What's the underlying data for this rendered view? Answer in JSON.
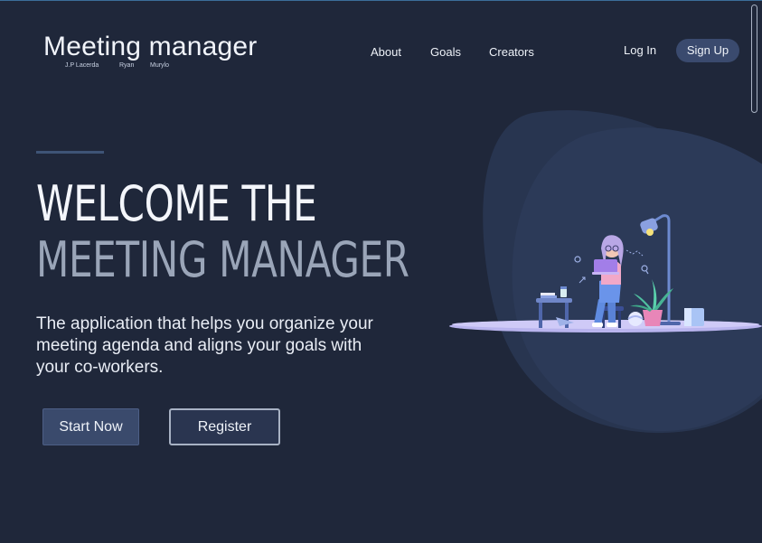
{
  "logo": {
    "title": "Meeting manager",
    "credits": [
      "J.P Lacerda",
      "Ryan",
      "Murylo"
    ]
  },
  "nav": {
    "links": [
      "About",
      "Goals",
      "Creators"
    ],
    "login_label": "Log In",
    "signup_label": "Sign Up"
  },
  "hero": {
    "headline_line1": "WELCOME THE",
    "headline_line2": "MEETING MANAGER",
    "subtitle": "The application that helps you organize your meeting agenda and aligns your goals with your co-workers.",
    "start_label": "Start Now",
    "register_label": "Register"
  },
  "colors": {
    "background": "#1f273a",
    "blob": "#2b3955",
    "button_primary": "#3a4a6c",
    "headline_muted": "#9aa5b8",
    "platform": "#b9b4ee"
  },
  "icons": [
    "woman-with-laptop-illustration",
    "floor-lamp-icon",
    "potted-plant-icon",
    "side-table-icon"
  ]
}
